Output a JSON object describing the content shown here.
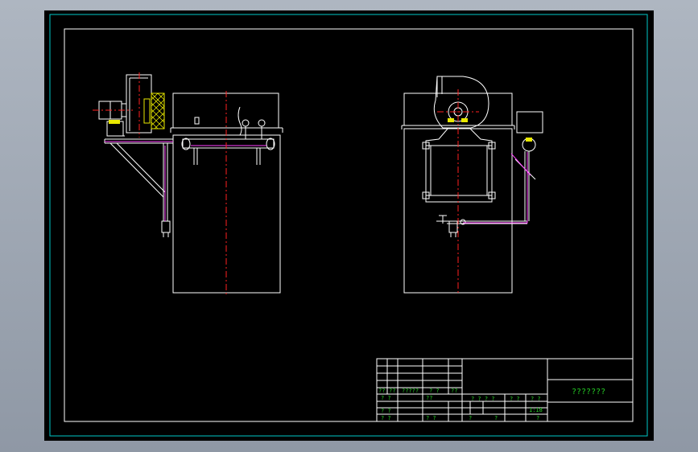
{
  "colors": {
    "background": "#000000",
    "outer_frame": "#00c8c8",
    "lines": "#ffffff",
    "centerline": "#ff2020",
    "hatch": "#e8e800",
    "pipe": "#ff40ff",
    "title_text": "#25d025"
  },
  "title_block": {
    "drawing_title": "???????",
    "scale": "1:18",
    "row1": [
      "??",
      "??",
      "?????",
      "?  ?",
      "??"
    ],
    "row2_left": [
      "?  ?",
      "??"
    ],
    "row2_right": [
      "?  ?  ?  ?",
      "?  ?",
      "?  ?"
    ],
    "row3_left": [
      "?  ?"
    ],
    "row4_left": [
      "?  ?",
      "?  ?"
    ],
    "row4_right": [
      "?",
      "?",
      "?"
    ]
  }
}
